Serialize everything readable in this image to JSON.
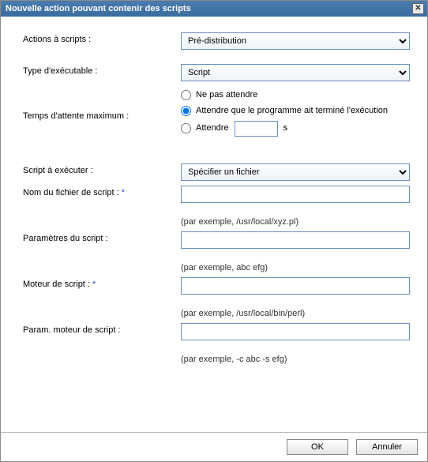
{
  "title": "Nouvelle action pouvant contenir des scripts",
  "form": {
    "actions_label": "Actions à scripts :",
    "actions_value": "Pré-distribution",
    "exec_type_label": "Type d'exécutable :",
    "exec_type_value": "Script",
    "wait_label": "Temps d'attente maximum :",
    "wait_options": {
      "no_wait": "Ne pas attendre",
      "wait_done": "Attendre que le programme ait terminé l'exécution",
      "wait_n": "Attendre",
      "wait_n_value": "",
      "wait_n_unit": "s",
      "selected": "wait_done"
    },
    "script_to_run_label": "Script à exécuter :",
    "script_to_run_value": "Spécifier un fichier",
    "script_file_label": "Nom du fichier de script :",
    "script_file_required": "*",
    "script_file_value": "",
    "script_file_hint": "(par exemple, /usr/local/xyz.pl)",
    "params_label": "Paramètres du script :",
    "params_value": "",
    "params_hint": "(par exemple, abc efg)",
    "engine_label": "Moteur de script :",
    "engine_required": "*",
    "engine_value": "",
    "engine_hint": "(par exemple, /usr/local/bin/perl)",
    "engine_params_label": "Param. moteur de script :",
    "engine_params_value": "",
    "engine_params_hint": "(par exemple, -c abc -s efg)"
  },
  "buttons": {
    "ok": "OK",
    "cancel": "Annuler"
  }
}
